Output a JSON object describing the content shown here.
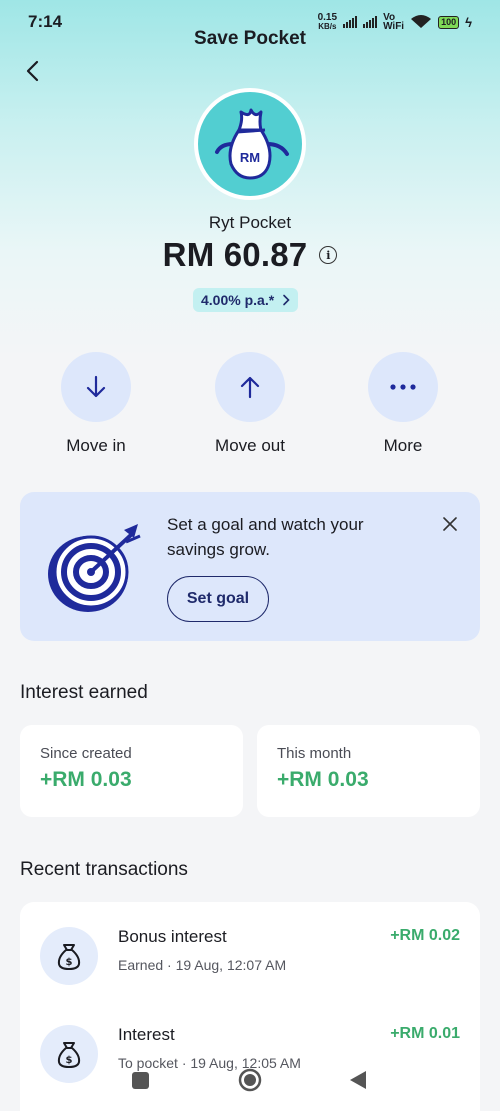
{
  "status_bar": {
    "time": "7:14",
    "net_speed": "0.15",
    "net_unit": "KB/s",
    "vowifi_top": "Vo",
    "vowifi_bottom": "WiFi",
    "battery": "100"
  },
  "header": {
    "title": "Save Pocket",
    "back_icon": "chevron-left-icon"
  },
  "pocket": {
    "avatar_text": "RM",
    "name": "Ryt Pocket",
    "balance": "RM 60.87",
    "rate": "4.00% p.a.*",
    "accent": "#52ced1"
  },
  "actions": [
    {
      "label": "Move in",
      "icon": "arrow-down-icon"
    },
    {
      "label": "Move out",
      "icon": "arrow-up-icon"
    },
    {
      "label": "More",
      "icon": "more-dots-icon"
    }
  ],
  "goal_card": {
    "text": "Set a goal and watch your savings grow.",
    "button": "Set goal"
  },
  "interest": {
    "title": "Interest earned",
    "cards": [
      {
        "label": "Since created",
        "value": "+RM 0.03"
      },
      {
        "label": "This month",
        "value": "+RM 0.03"
      }
    ]
  },
  "transactions": {
    "title": "Recent transactions",
    "items": [
      {
        "title": "Bonus interest",
        "subtitle": "Earned · 19 Aug, 12:07 AM",
        "amount": "+RM 0.02"
      },
      {
        "title": "Interest",
        "subtitle": "To pocket · 19 Aug, 12:05 AM",
        "amount": "+RM 0.01"
      }
    ]
  },
  "colors": {
    "positive": "#3aab6c",
    "navy": "#1f2a6b",
    "action_bg": "#dde7fb"
  }
}
